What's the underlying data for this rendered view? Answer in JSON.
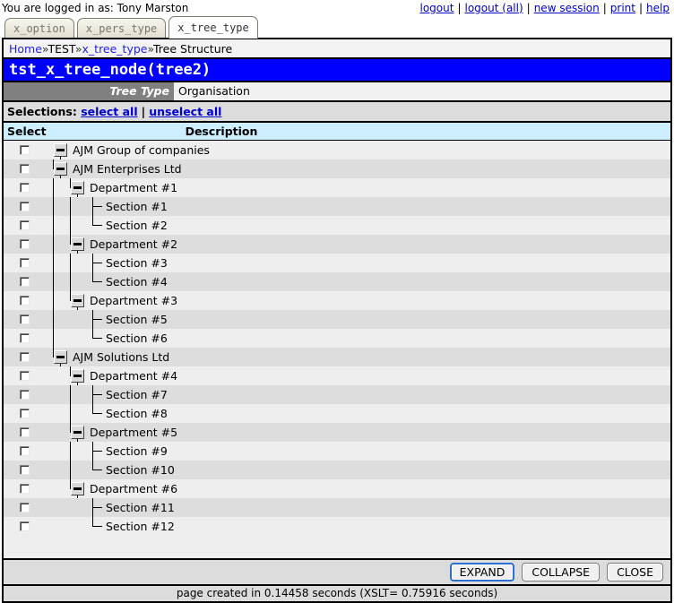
{
  "topbar": {
    "login_text": "You are logged in as: Tony Marston",
    "links": [
      {
        "label": "logout"
      },
      {
        "label": "logout (all)"
      },
      {
        "label": "new session"
      },
      {
        "label": "print"
      },
      {
        "label": "help"
      }
    ],
    "separator": "|"
  },
  "tabs": [
    {
      "label": "x_option",
      "active": false
    },
    {
      "label": "x_pers_type",
      "active": false
    },
    {
      "label": "x_tree_type",
      "active": true
    }
  ],
  "breadcrumb": {
    "home": "Home",
    "sep": "»",
    "test": "TEST",
    "tree_type": "x_tree_type",
    "current": "Tree Structure"
  },
  "title": "tst_x_tree_node(tree2)",
  "field": {
    "label": "Tree Type",
    "value": "Organisation"
  },
  "selections": {
    "label": "Selections:",
    "select_all": "select all",
    "separator": "|",
    "unselect_all": "unselect all"
  },
  "columns": {
    "select": "Select",
    "description": "Description"
  },
  "tree_rows": [
    {
      "level": 0,
      "type": "node",
      "label": "AJM Group of companies"
    },
    {
      "level": 1,
      "type": "node",
      "label": "AJM Enterprises Ltd"
    },
    {
      "level": 2,
      "type": "node",
      "label": "Department #1"
    },
    {
      "level": 3,
      "type": "tee",
      "label": "Section #1"
    },
    {
      "level": 3,
      "type": "elbow",
      "label": "Section #2"
    },
    {
      "level": 2,
      "type": "node",
      "label": "Department #2"
    },
    {
      "level": 3,
      "type": "tee",
      "label": "Section #3"
    },
    {
      "level": 3,
      "type": "elbow",
      "label": "Section #4"
    },
    {
      "level": 2,
      "type": "node",
      "label": "Department #3"
    },
    {
      "level": 3,
      "type": "tee",
      "label": "Section #5"
    },
    {
      "level": 3,
      "type": "elbow",
      "label": "Section #6"
    },
    {
      "level": 1,
      "type": "node",
      "label": "AJM Solutions Ltd"
    },
    {
      "level": 2,
      "type": "node",
      "label": "Department #4"
    },
    {
      "level": 3,
      "type": "tee",
      "label": "Section #7"
    },
    {
      "level": 3,
      "type": "elbow",
      "label": "Section #8"
    },
    {
      "level": 2,
      "type": "node",
      "label": "Department #5"
    },
    {
      "level": 3,
      "type": "tee",
      "label": "Section #9"
    },
    {
      "level": 3,
      "type": "elbow",
      "label": "Section #10"
    },
    {
      "level": 2,
      "type": "node",
      "label": "Department #6"
    },
    {
      "level": 3,
      "type": "tee",
      "label": "Section #11"
    },
    {
      "level": 3,
      "type": "elbow",
      "label": "Section #12"
    }
  ],
  "buttons": [
    {
      "label": "EXPAND",
      "default": true
    },
    {
      "label": "COLLAPSE",
      "default": false
    },
    {
      "label": "CLOSE",
      "default": false
    }
  ],
  "footer": "page created in 0.14458 seconds (XSLT= 0.75916 seconds)",
  "colors": {
    "title_bg": "#0000ff",
    "field_label_bg": "#808080",
    "column_header_bg": "#cceeff",
    "row_odd": "#eeeeee",
    "row_even": "#dddddd",
    "bar_bg": "#dcdcdc",
    "link": "#0000cc",
    "default_button_border": "#2b6fd4"
  }
}
